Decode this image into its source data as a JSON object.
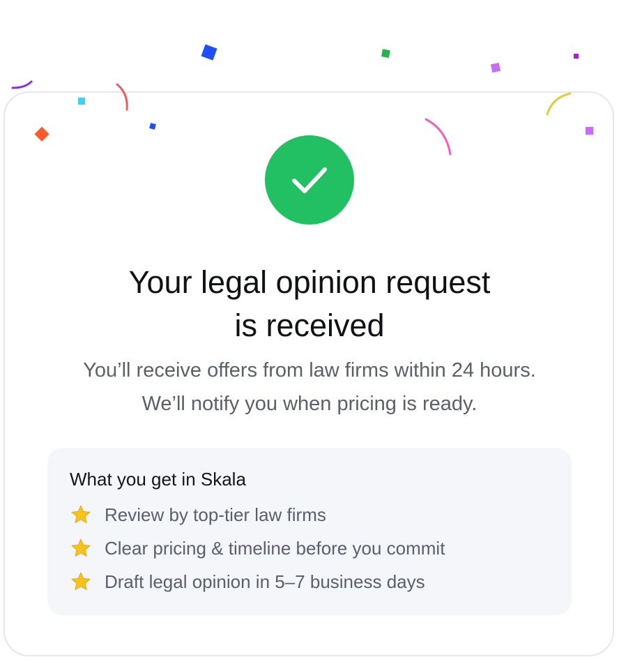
{
  "colors": {
    "success_green": "#22c063",
    "star_yellow": "#f8c21c",
    "title_text": "#0f1115",
    "body_text": "#5a5f6b",
    "panel_bg": "#f5f6f9"
  },
  "icons": {
    "status": "checkmark-icon",
    "benefit": "star-icon"
  },
  "confirmation": {
    "title_line1": "Your legal opinion request",
    "title_line2": "is received",
    "subtitle_line1": "You’ll receive offers from law firms within 24 hours.",
    "subtitle_line2": "We’ll notify you when pricing is ready."
  },
  "benefits": {
    "title": "What you get in Skala",
    "items": [
      {
        "label": "Review by top-tier law firms"
      },
      {
        "label": "Clear pricing & timeline before you commit"
      },
      {
        "label": "Draft legal opinion in 5–7 business days"
      }
    ]
  }
}
